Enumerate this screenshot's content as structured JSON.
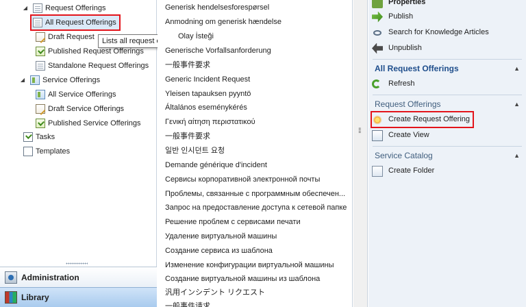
{
  "navigation": {
    "tree": {
      "request_offerings": "Request Offerings",
      "all_request_offerings": "All Request Offerings",
      "draft_request": "Draft Request",
      "published_request_offerings": "Published Request Offerings",
      "standalone_request_offerings": "Standalone Request Offerings",
      "service_offerings": "Service Offerings",
      "all_service_offerings": "All Service Offerings",
      "draft_service_offerings": "Draft Service Offerings",
      "published_service_offerings": "Published Service Offerings",
      "tasks": "Tasks",
      "templates": "Templates"
    },
    "tooltip": "Lists all request offerings",
    "wunderbar": {
      "administration": "Administration",
      "library": "Library"
    }
  },
  "list": {
    "items": [
      "Generisk hendelsesforespørsel",
      "Anmodning om generisk hændelse",
      "Olay İsteği",
      "Generische Vorfallsanforderung",
      "一般事件要求",
      "Generic Incident Request",
      "Yleisen tapauksen pyyntö",
      "Általános eseménykérés",
      "Γενική αίτηση περιστατικού",
      "一般事件要求",
      "일반 인시던트 요청",
      "Demande générique d'incident",
      "Сервисы корпоративной электронной почты",
      "Проблемы, связанные с программным обеспечен...",
      "Запрос на предоставление доступа к сетевой папке",
      "Решение проблем с сервисами печати",
      "Удаление виртуальной машины",
      "Создание сервиса из шаблона",
      "Изменение конфигурации виртуальной машины",
      "Создание виртуальной машины из шаблона",
      "汎用インシデント リクエスト",
      "一般事件请求"
    ]
  },
  "tasks": {
    "properties": "Properties",
    "publish": "Publish",
    "search_kb": "Search for Knowledge Articles",
    "unpublish": "Unpublish",
    "section_all_request_offerings": "All Request Offerings",
    "refresh": "Refresh",
    "section_request_offerings": "Request Offerings",
    "create_request_offering": "Create Request Offering",
    "create_view": "Create View",
    "section_service_catalog": "Service Catalog",
    "create_folder": "Create Folder",
    "collapse_glyph": "▲"
  },
  "colors": {
    "highlight_box": "#e3141b",
    "section_title": "#1f4e8c",
    "tasks_background": "#edf2f8",
    "wunderbar_selected": "#a9cbee"
  },
  "icons": {
    "tree_expand": "triangle-expanded-icon",
    "publish": "green-arrow-icon",
    "search": "search-icon",
    "unpublish": "back-arrow-icon",
    "refresh": "refresh-icon",
    "create": "starburst-icon",
    "view": "view-icon",
    "folder": "folder-icon"
  }
}
